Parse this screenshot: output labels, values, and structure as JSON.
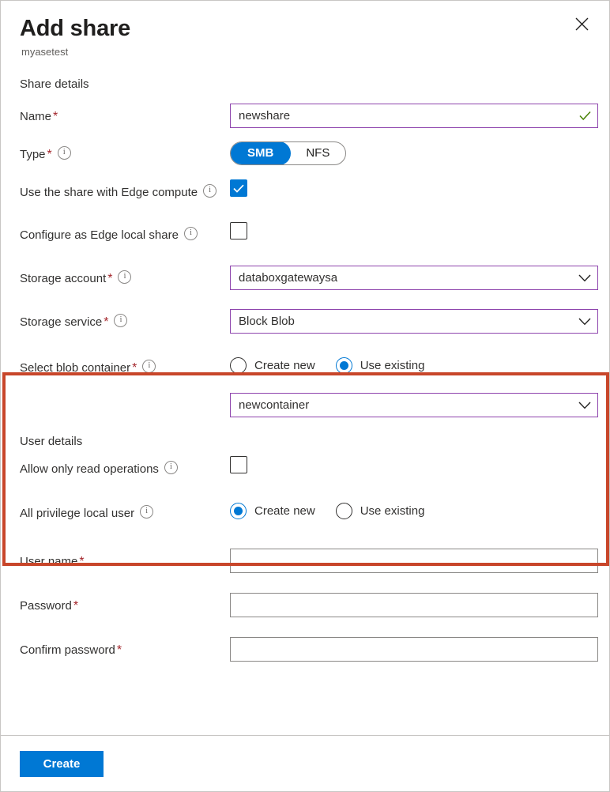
{
  "header": {
    "title": "Add share",
    "subtitle": "myasetest",
    "close_icon": "close-icon"
  },
  "share_details": {
    "section_title": "Share details",
    "name": {
      "label": "Name",
      "required": "*",
      "value": "newshare",
      "valid_icon": "checkmark-icon"
    },
    "type": {
      "label": "Type",
      "required": "*",
      "info_icon": "info-icon",
      "options": [
        "SMB",
        "NFS"
      ],
      "selected": "SMB"
    },
    "edge_compute": {
      "label": "Use the share with Edge compute",
      "info_icon": "info-icon",
      "checked": true
    },
    "edge_local_share": {
      "label": "Configure as Edge local share",
      "info_icon": "info-icon",
      "checked": false
    },
    "storage_account": {
      "label": "Storage account",
      "required": "*",
      "info_icon": "info-icon",
      "value": "databoxgatewaysa",
      "chevron_icon": "chevron-down-icon"
    },
    "storage_service": {
      "label": "Storage service",
      "required": "*",
      "info_icon": "info-icon",
      "value": "Block Blob",
      "chevron_icon": "chevron-down-icon"
    },
    "blob_container": {
      "label": "Select blob container",
      "required": "*",
      "info_icon": "info-icon",
      "option_create": "Create new",
      "option_existing": "Use existing",
      "selected": "Use existing",
      "value": "newcontainer",
      "chevron_icon": "chevron-down-icon"
    }
  },
  "user_details": {
    "section_title": "User details",
    "read_only": {
      "label": "Allow only read operations",
      "info_icon": "info-icon",
      "checked": false
    },
    "privilege_user": {
      "label": "All privilege local user",
      "info_icon": "info-icon",
      "option_create": "Create new",
      "option_existing": "Use existing",
      "selected": "Create new"
    },
    "user_name": {
      "label": "User name",
      "required": "*",
      "value": ""
    },
    "password": {
      "label": "Password",
      "required": "*",
      "value": ""
    },
    "confirm_password": {
      "label": "Confirm password",
      "required": "*",
      "value": ""
    }
  },
  "footer": {
    "create_label": "Create"
  },
  "colors": {
    "accent": "#0078d4",
    "field_border": "#8e44ad",
    "required": "#a4262c",
    "annotation": "#c8462a",
    "valid": "#498205"
  }
}
